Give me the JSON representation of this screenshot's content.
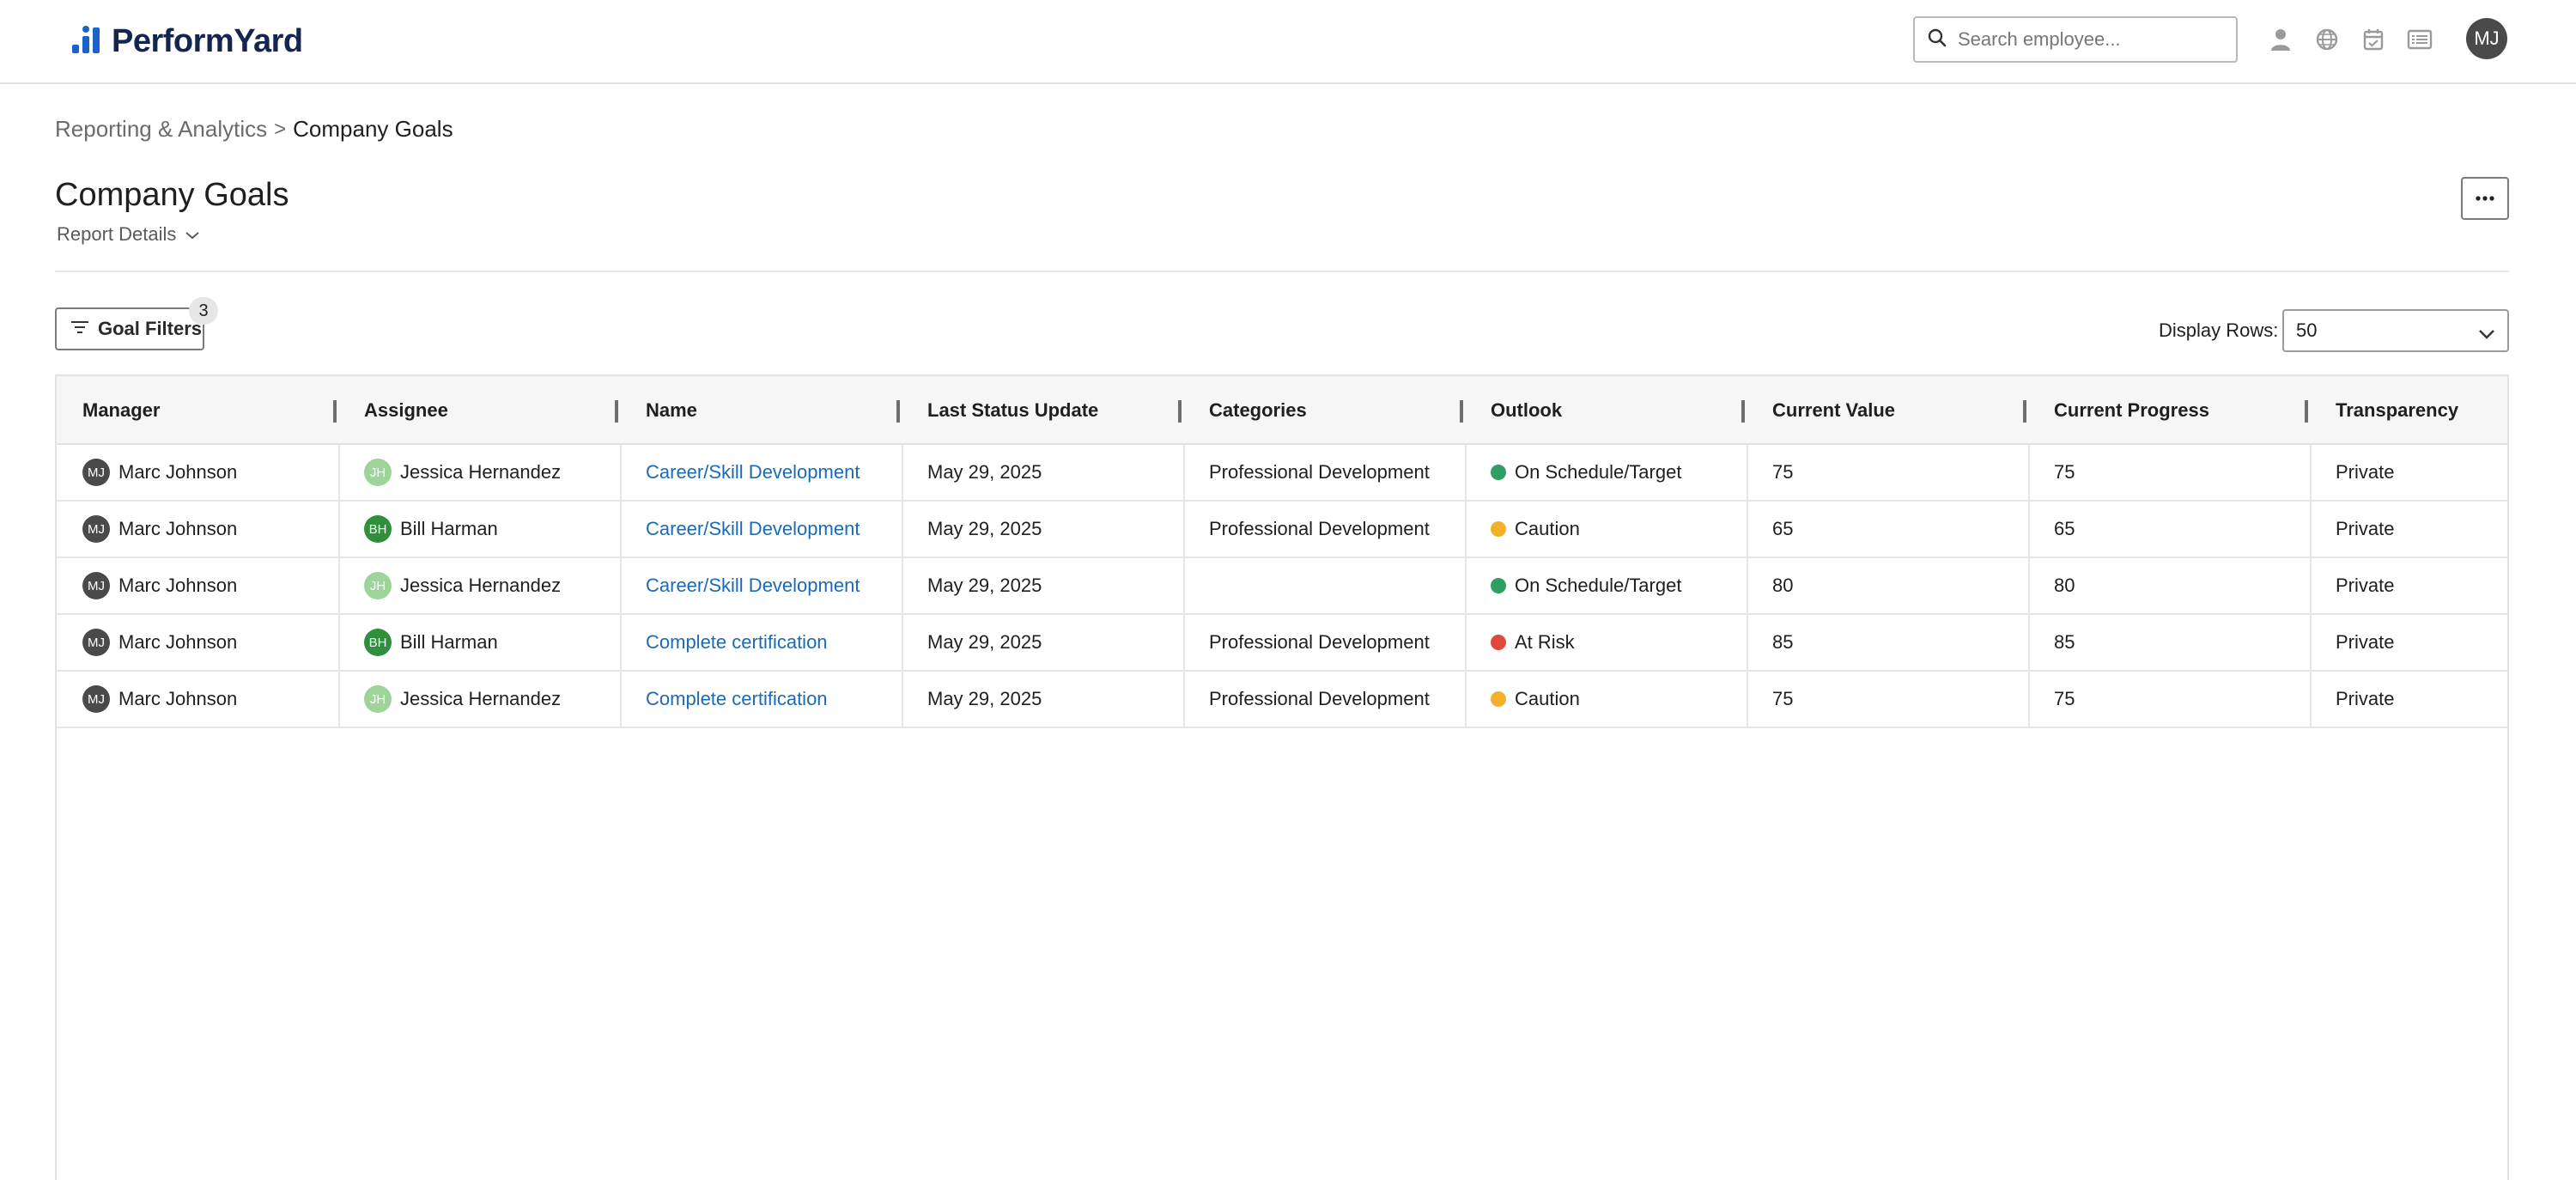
{
  "header": {
    "logo_text": "PerformYard",
    "search_placeholder": "Search employee...",
    "user_initials": "MJ",
    "icons": [
      "person-icon",
      "globe-icon",
      "calendar-check-icon",
      "list-icon"
    ]
  },
  "breadcrumb": {
    "parent": "Reporting & Analytics",
    "separator": ">",
    "current": "Company Goals"
  },
  "page": {
    "title": "Company Goals",
    "report_details": "Report Details",
    "more_icon": "ellipsis-icon"
  },
  "filters": {
    "button_label": "Goal Filters",
    "count": "3",
    "display_rows_label": "Display Rows:",
    "display_rows_value": "50"
  },
  "colors": {
    "brand": "#1a63c9",
    "link": "#1a6ab5",
    "status_green": "#2e9e62",
    "status_yellow": "#f2b12c",
    "status_red": "#e0483d",
    "avatar_mj": "#4a4a4a",
    "avatar_jh": "#9ed49a",
    "avatar_bh": "#2f8f3d"
  },
  "table": {
    "columns": [
      "Manager",
      "Assignee",
      "Name",
      "Last Status Update",
      "Categories",
      "Outlook",
      "Current Value",
      "Current Progress",
      "Transparency"
    ],
    "rows": [
      {
        "manager_initials": "MJ",
        "manager": "Marc Johnson",
        "assignee_initials": "JH",
        "assignee": "Jessica Hernandez",
        "name": "Career/Skill Development",
        "last_update": "May 29, 2025",
        "category": "Professional Development",
        "outlook": "On Schedule/Target",
        "outlook_color": "#2e9e62",
        "current_value": "75",
        "current_progress": "75",
        "transparency": "Private"
      },
      {
        "manager_initials": "MJ",
        "manager": "Marc Johnson",
        "assignee_initials": "BH",
        "assignee": "Bill Harman",
        "name": "Career/Skill Development",
        "last_update": "May 29, 2025",
        "category": "Professional Development",
        "outlook": "Caution",
        "outlook_color": "#f2b12c",
        "current_value": "65",
        "current_progress": "65",
        "transparency": "Private"
      },
      {
        "manager_initials": "MJ",
        "manager": "Marc Johnson",
        "assignee_initials": "JH",
        "assignee": "Jessica Hernandez",
        "name": "Career/Skill Development",
        "last_update": "May 29, 2025",
        "category": "",
        "outlook": "On Schedule/Target",
        "outlook_color": "#2e9e62",
        "current_value": "80",
        "current_progress": "80",
        "transparency": "Private"
      },
      {
        "manager_initials": "MJ",
        "manager": "Marc Johnson",
        "assignee_initials": "BH",
        "assignee": "Bill Harman",
        "name": "Complete certification",
        "last_update": "May 29, 2025",
        "category": "Professional Development",
        "outlook": "At Risk",
        "outlook_color": "#e0483d",
        "current_value": "85",
        "current_progress": "85",
        "transparency": "Private"
      },
      {
        "manager_initials": "MJ",
        "manager": "Marc Johnson",
        "assignee_initials": "JH",
        "assignee": "Jessica Hernandez",
        "name": "Complete certification",
        "last_update": "May 29, 2025",
        "category": "Professional Development",
        "outlook": "Caution",
        "outlook_color": "#f2b12c",
        "current_value": "75",
        "current_progress": "75",
        "transparency": "Private"
      }
    ]
  }
}
